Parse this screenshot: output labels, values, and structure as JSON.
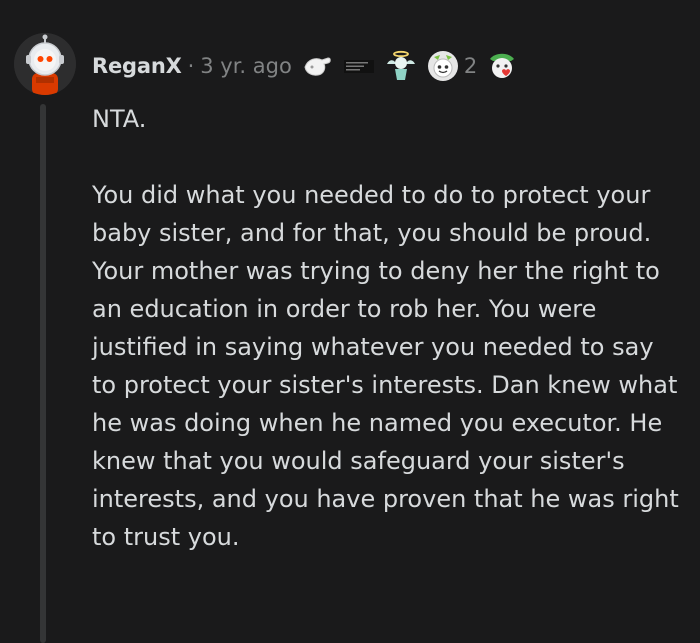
{
  "comment": {
    "username": "ReganX",
    "separator": "·",
    "timestamp": "3 yr. ago",
    "award_count": "2",
    "awards": [
      "hand-award-icon",
      "pixel-text-award-icon",
      "angel-award-icon",
      "snoo-award-icon",
      "heart-snoo-award-icon"
    ],
    "paragraphs": [
      "NTA.",
      "You did what you needed to do to protect your baby sister, and for that, you should be proud. Your mother was trying to deny her the right to an education in order to rob her. You were justified in saying whatever you needed to say to protect your sister's interests. Dan knew what he was doing when he named you executor. He knew that you would safeguard your sister's interests, and you have proven that he was right to trust you."
    ]
  },
  "colors": {
    "background": "#1a1a1b",
    "text": "#d7dadc",
    "meta": "#818384",
    "thread_line": "#343536"
  }
}
